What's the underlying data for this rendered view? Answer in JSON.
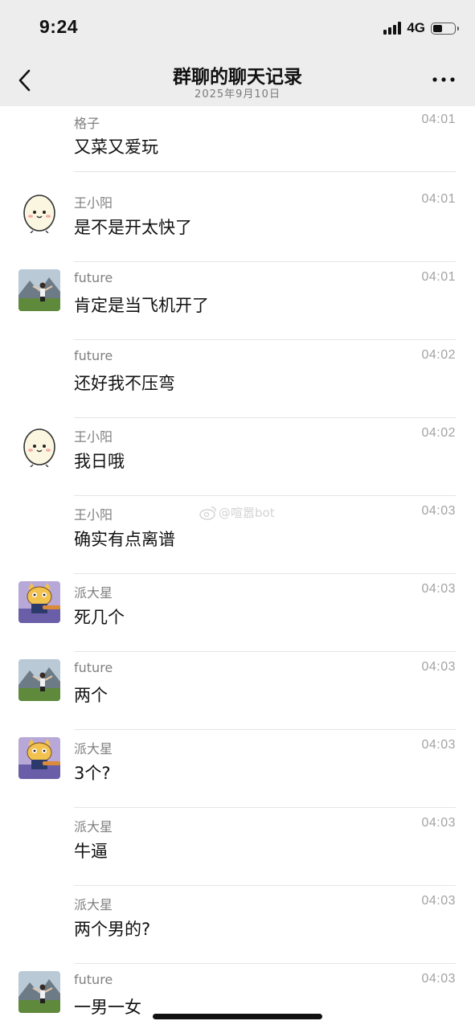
{
  "status_bar": {
    "time": "9:24",
    "network": "4G",
    "battery_level": 0.35
  },
  "nav": {
    "title": "群聊的聊天记录",
    "subtitle": "2025年9月10日"
  },
  "watermark": "@喧嚣bot",
  "messages": [
    {
      "sender": "格子",
      "time": "04:01",
      "text": "又菜又爱玩",
      "avatar": "none"
    },
    {
      "sender": "王小阳",
      "time": "04:01",
      "text": "是不是开太快了",
      "avatar": "egg-avatar"
    },
    {
      "sender": "future",
      "time": "04:01",
      "text": "肯定是当飞机开了",
      "avatar": "landscape-avatar"
    },
    {
      "sender": "future",
      "time": "04:02",
      "text": "还好我不压弯",
      "avatar": "none"
    },
    {
      "sender": "王小阳",
      "time": "04:02",
      "text": "我日哦",
      "avatar": "egg-avatar"
    },
    {
      "sender": "王小阳",
      "time": "04:03",
      "text": "确实有点离谱",
      "avatar": "none"
    },
    {
      "sender": "派大星",
      "time": "04:03",
      "text": "死几个",
      "avatar": "cat-avatar"
    },
    {
      "sender": "future",
      "time": "04:03",
      "text": "两个",
      "avatar": "landscape-avatar"
    },
    {
      "sender": "派大星",
      "time": "04:03",
      "text": "3个?",
      "avatar": "cat-avatar"
    },
    {
      "sender": "派大星",
      "time": "04:03",
      "text": "牛逼",
      "avatar": "none"
    },
    {
      "sender": "派大星",
      "time": "04:03",
      "text": "两个男的?",
      "avatar": "none"
    },
    {
      "sender": "future",
      "time": "04:03",
      "text": "一男一女",
      "avatar": "landscape-avatar"
    }
  ]
}
